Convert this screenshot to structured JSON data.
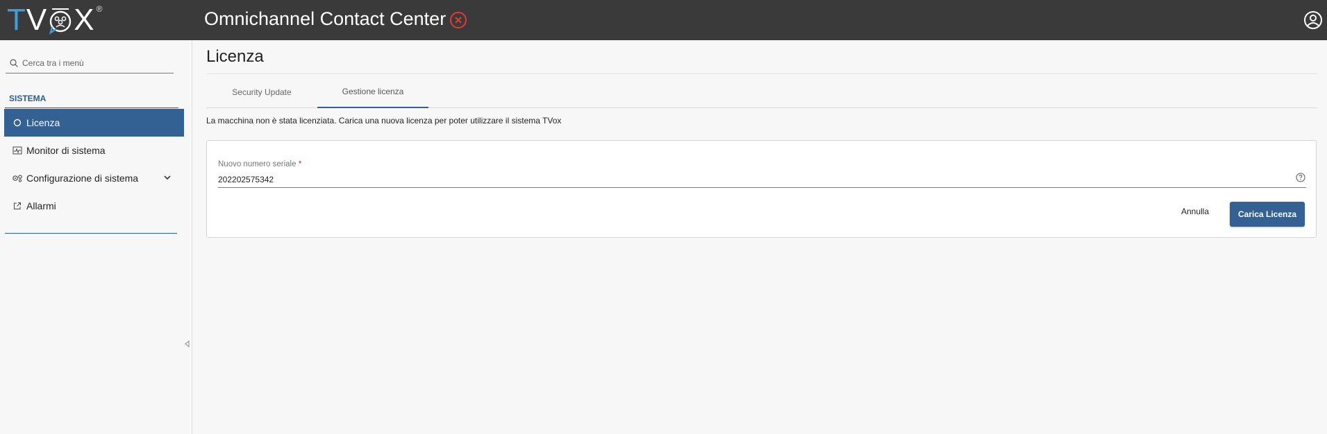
{
  "brand": {
    "logo_t": "T",
    "logo_v": "V",
    "logo_x": "X",
    "logo_reg": "®",
    "accent_color": "#3e9fd8"
  },
  "header": {
    "title": "Omnichannel Contact Center",
    "status_icon": "error-circle-icon",
    "status_color": "#e53935",
    "user_icon": "user-circle-icon"
  },
  "sidebar": {
    "search_placeholder": "Cerca tra i menù",
    "section": "SISTEMA",
    "items": [
      {
        "label": "Licenza",
        "icon": "circle-icon",
        "active": true
      },
      {
        "label": "Monitor di sistema",
        "icon": "monitor-chart-icon",
        "active": false
      },
      {
        "label": "Configurazione di sistema",
        "icon": "gears-icon",
        "active": false,
        "expandable": true
      },
      {
        "label": "Allarmi",
        "icon": "external-link-icon",
        "active": false
      }
    ]
  },
  "main": {
    "title": "Licenza",
    "tabs": [
      {
        "label": "Security Update",
        "active": false
      },
      {
        "label": "Gestione licenza",
        "active": true
      }
    ],
    "info_text": "La macchina non è stata licenziata. Carica una nuova licenza per poter utilizzare il sistema TVox",
    "form": {
      "serial_label": "Nuovo numero seriale",
      "required_marker": "*",
      "serial_value": "202202575342",
      "cancel_label": "Annulla",
      "submit_label": "Carica Licenza"
    }
  }
}
